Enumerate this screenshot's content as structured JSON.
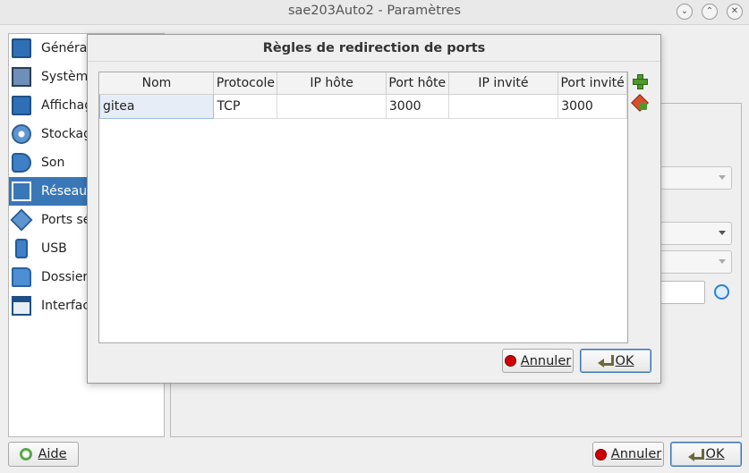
{
  "window": {
    "title": "sae203Auto2 - Paramètres"
  },
  "sidebar": {
    "items": [
      {
        "label": "Général",
        "icon": "monitor-icon"
      },
      {
        "label": "Système",
        "icon": "chip-icon"
      },
      {
        "label": "Affichage",
        "icon": "display-icon"
      },
      {
        "label": "Stockage",
        "icon": "disk-icon"
      },
      {
        "label": "Son",
        "icon": "speaker-icon"
      },
      {
        "label": "Réseau",
        "icon": "network-icon",
        "selected": true
      },
      {
        "label": "Ports séries",
        "icon": "serial-port-icon"
      },
      {
        "label": "USB",
        "icon": "usb-icon"
      },
      {
        "label": "Dossiers partagés",
        "icon": "folder-icon"
      },
      {
        "label": "Interface utilisateur",
        "icon": "ui-icon"
      }
    ]
  },
  "footer": {
    "help": "Aide",
    "cancel": "Annuler",
    "ok": "OK"
  },
  "dialog": {
    "title": "Règles de redirection de ports",
    "columns": [
      "Nom",
      "Protocole",
      "IP hôte",
      "Port hôte",
      "IP invité",
      "Port invité"
    ],
    "rows": [
      {
        "name": "gitea",
        "protocol": "TCP",
        "host_ip": "",
        "host_port": "3000",
        "guest_ip": "",
        "guest_port": "3000"
      }
    ],
    "cancel": "Annuler",
    "ok": "OK"
  },
  "colors": {
    "selection": "#3a77b7",
    "cancel_dot": "#d00000"
  }
}
